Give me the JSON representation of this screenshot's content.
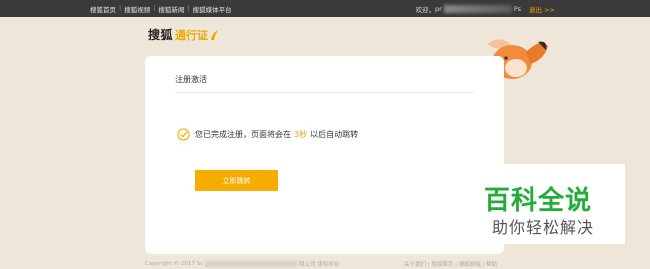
{
  "topbar": {
    "nav": [
      "搜狐首页",
      "搜狐视频",
      "搜狐新闻",
      "搜狐媒体平台"
    ],
    "separator": "|",
    "greeting": "欢迎，",
    "user_prefix": "pr",
    "user_suffix": "Ps",
    "logout": "退出 >>"
  },
  "logo": {
    "main": "搜狐",
    "sub": "通行证"
  },
  "card": {
    "title": "注册激活",
    "message_before": "您已完成注册，页面将会在",
    "countdown": "3秒",
    "message_after": "以后自动跳转",
    "button": "立即跳转"
  },
  "footer": {
    "copyright_prefix": "Copyright © 2017 Sc",
    "copyright_suffix": "限公司 版权所有",
    "links": "关于我们 | 搜狐首页 | 搜狐邮箱 | 帮助"
  },
  "watermark": {
    "main": "百科全说",
    "sub": "助你轻松解决"
  },
  "colors": {
    "accent": "#f6ad00",
    "topbar": "#3a3a3a",
    "page_bg": "#efe6da",
    "watermark_green": "#22ad38"
  }
}
